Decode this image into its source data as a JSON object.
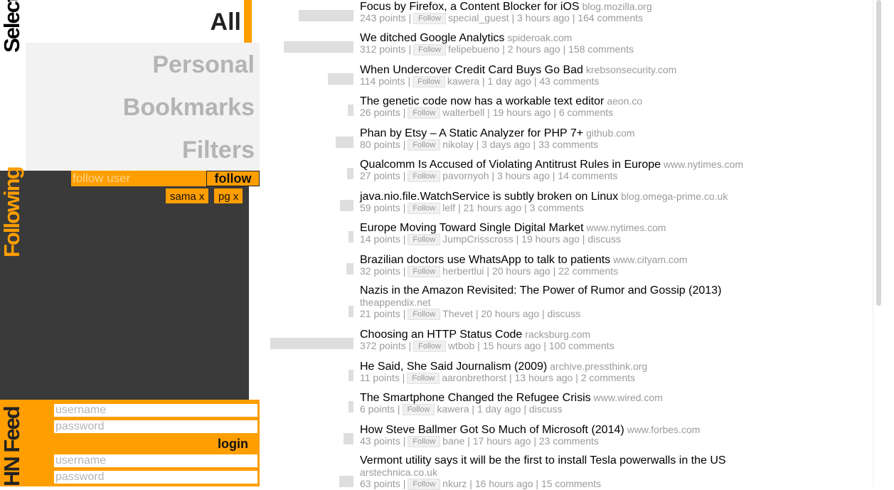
{
  "sidebar": {
    "select_title": "Select",
    "all_label": "All",
    "items": [
      {
        "label": "Personal"
      },
      {
        "label": "Bookmarks"
      },
      {
        "label": "Filters"
      }
    ],
    "following_title": "Following",
    "follow_placeholder": "follow user",
    "follow_button": "follow",
    "followed_users": [
      {
        "label": "sama x"
      },
      {
        "label": "pg x"
      }
    ],
    "hnfeed_title": "HN Feed",
    "username_placeholder": "username",
    "password_placeholder": "password",
    "login_button": "login"
  },
  "follow_label": "Follow",
  "colors": {
    "accent": "#ff9e00",
    "dark_panel": "#3a3a3a",
    "light_panel": "#f2f2f2",
    "bar": "#dedede"
  },
  "stories": [
    {
      "title": "Focus by Firefox, a Content Blocker for iOS",
      "domain": "blog.mozilla.org",
      "points": "243 points",
      "user": "special_guest",
      "age": "3 hours ago",
      "comments": "164 comments",
      "score": 243
    },
    {
      "title": "We ditched Google Analytics",
      "domain": "spideroak.com",
      "points": "312 points",
      "user": "felipebueno",
      "age": "2 hours ago",
      "comments": "158 comments",
      "score": 312
    },
    {
      "title": "When Undercover Credit Card Buys Go Bad",
      "domain": "krebsonsecurity.com",
      "points": "114 points",
      "user": "kawera",
      "age": "1 day ago",
      "comments": "43 comments",
      "score": 114
    },
    {
      "title": "The genetic code now has a workable text editor",
      "domain": "aeon.co",
      "points": "26 points",
      "user": "walterbell",
      "age": "19 hours ago",
      "comments": "6 comments",
      "score": 26
    },
    {
      "title": "Phan by Etsy – A Static Analyzer for PHP 7+",
      "domain": "github.com",
      "points": "80 points",
      "user": "nikolay",
      "age": "3 days ago",
      "comments": "33 comments",
      "score": 80
    },
    {
      "title": "Qualcomm Is Accused of Violating Antitrust Rules in Europe",
      "domain": "www.nytimes.com",
      "points": "27 points",
      "user": "pavornyoh",
      "age": "3 hours ago",
      "comments": "14 comments",
      "score": 27
    },
    {
      "title": "java.nio.file.WatchService is subtly broken on Linux",
      "domain": "blog.omega-prime.co.uk",
      "points": "59 points",
      "user": "lelf",
      "age": "21 hours ago",
      "comments": "3 comments",
      "score": 59
    },
    {
      "title": "Europe Moving Toward Single Digital Market",
      "domain": "www.nytimes.com",
      "points": "14 points",
      "user": "JumpCrisscross",
      "age": "19 hours ago",
      "comments": "discuss",
      "score": 14
    },
    {
      "title": "Brazilian doctors use WhatsApp to talk to patients",
      "domain": "www.cityam.com",
      "points": "32 points",
      "user": "herbertlui",
      "age": "20 hours ago",
      "comments": "22 comments",
      "score": 32
    },
    {
      "title": "Nazis in the Amazon Revisited: The Power of Rumor and Gossip (2013)",
      "domain": "theappendix.net",
      "points": "21 points",
      "user": "Thevet",
      "age": "20 hours ago",
      "comments": "discuss",
      "score": 21
    },
    {
      "title": "Choosing an HTTP Status Code",
      "domain": "racksburg.com",
      "points": "372 points",
      "user": "wtbob",
      "age": "15 hours ago",
      "comments": "100 comments",
      "score": 372
    },
    {
      "title": "He Said, She Said Journalism (2009)",
      "domain": "archive.pressthink.org",
      "points": "11 points",
      "user": "aaronbrethorst",
      "age": "13 hours ago",
      "comments": "2 comments",
      "score": 11
    },
    {
      "title": "The Smartphone Changed the Refugee Crisis",
      "domain": "www.wired.com",
      "points": "6 points",
      "user": "kawera",
      "age": "1 day ago",
      "comments": "discuss",
      "score": 6
    },
    {
      "title": "How Steve Ballmer Got So Much of Microsoft (2014)",
      "domain": "www.forbes.com",
      "points": "43 points",
      "user": "bane",
      "age": "17 hours ago",
      "comments": "23 comments",
      "score": 43
    },
    {
      "title": "Vermont utility says it will be the first to install Tesla powerwalls in the US",
      "domain": "arstechnica.co.uk",
      "points": "63 points",
      "user": "nkurz",
      "age": "16 hours ago",
      "comments": "15 comments",
      "score": 63
    }
  ]
}
